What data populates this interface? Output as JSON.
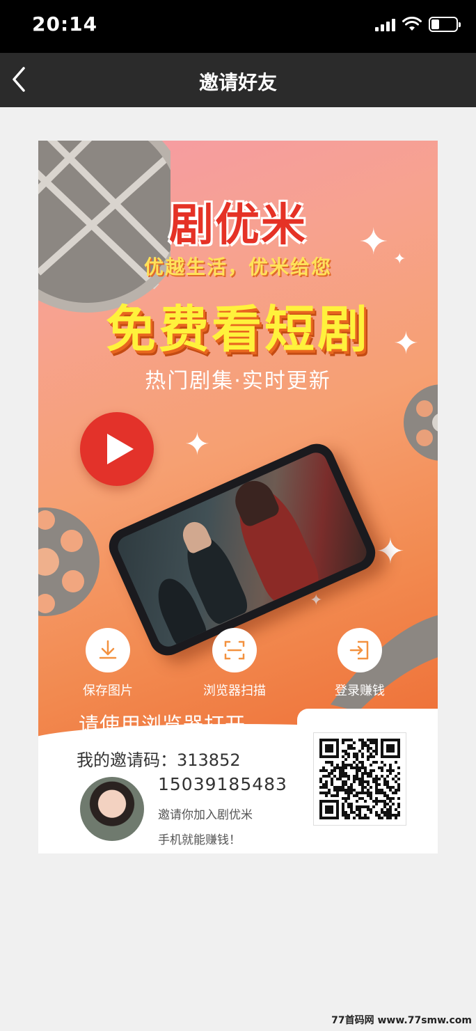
{
  "status_bar": {
    "time": "20:14",
    "battery_level": 0.25
  },
  "nav": {
    "title": "邀请好友",
    "back_icon": "chevron-left-icon"
  },
  "poster": {
    "brand": "剧优米",
    "slogan": "优越生活，优米给您",
    "headline": "免费看短剧",
    "subline": "热门剧集·实时更新",
    "actions": [
      {
        "label": "保存图片",
        "icon": "download-icon"
      },
      {
        "label": "浏览器扫描",
        "icon": "scan-icon"
      },
      {
        "label": "登录赚钱",
        "icon": "login-icon"
      }
    ],
    "open_hint": "请使用浏览器打开",
    "invite_code": "我的邀请码：313852",
    "phone_number": "15039185483",
    "invite_line": "邀请你加入剧优米",
    "earn_line": "手机就能赚钱！",
    "colors": {
      "brand_red": "#e53226",
      "headline_yellow": "#fff23c",
      "accent_orange": "#f3913f"
    }
  },
  "watermark": "77首码网 www.77smw.com"
}
